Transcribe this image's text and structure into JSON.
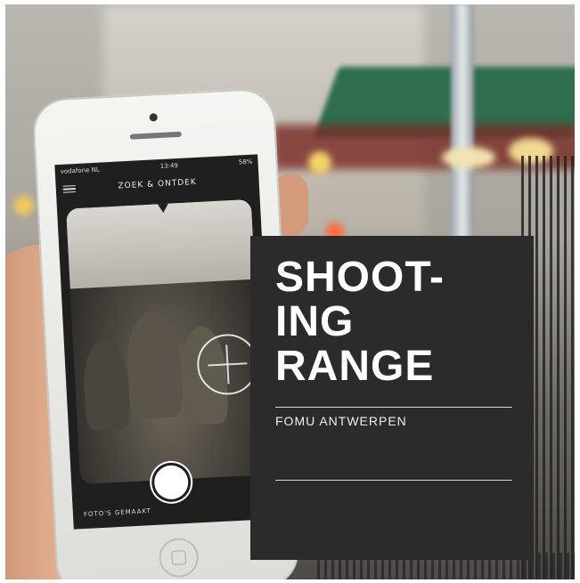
{
  "phone": {
    "carrier": "vodafone NL",
    "time": "13:49",
    "battery": "58%",
    "nav_title": "ZOEK & ONTDEK",
    "photos_label": "FOTO'S GEMAAKT"
  },
  "card": {
    "title_lines": [
      "SHOOT-",
      "ING",
      "RANGE"
    ],
    "subtitle": "FOMU ANTWERPEN"
  },
  "colors": {
    "card_bg": "#2b2b2b",
    "card_text": "#ffffff"
  },
  "icons": [
    "menu-icon",
    "wifi-icon",
    "battery-icon",
    "target-icon",
    "shutter-icon",
    "home-button-icon"
  ]
}
